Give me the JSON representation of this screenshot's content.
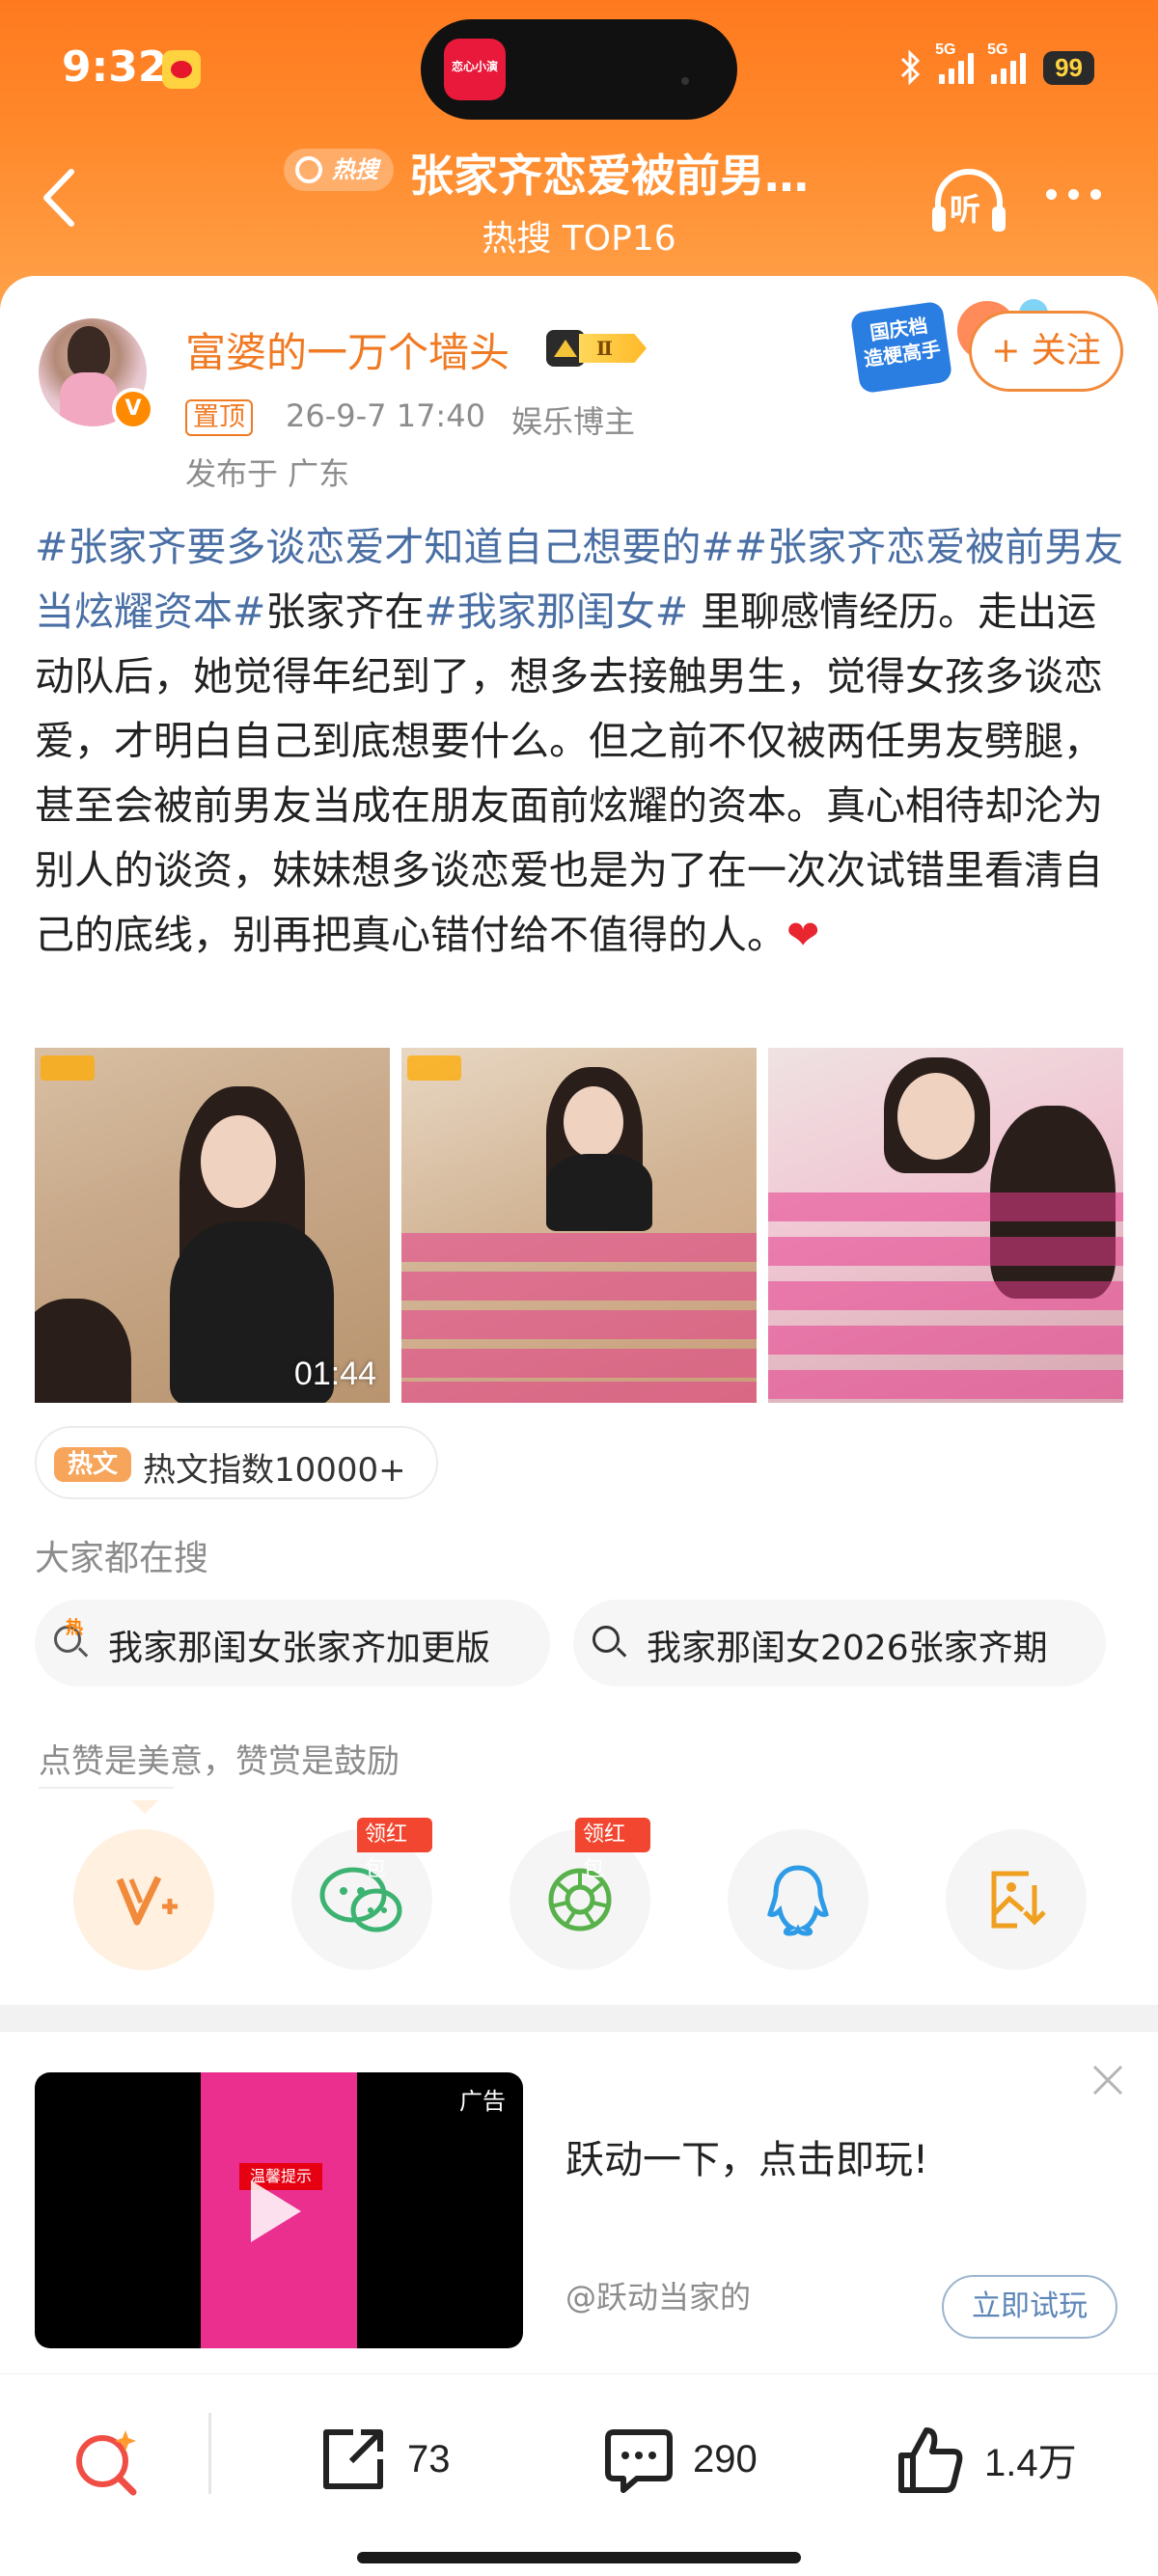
{
  "status": {
    "time": "9:32",
    "signal1": "5G",
    "signal2": "5G",
    "battery": "99",
    "island_app": "恋心小演"
  },
  "nav": {
    "hot_badge": "热搜",
    "title": "张家齐恋爱被前男…",
    "subtitle": "热搜 TOP16",
    "listen_label": "听"
  },
  "post": {
    "username": "富婆的一万个墙头",
    "level": "Ⅱ",
    "verified_mark": "V",
    "pin_label": "置顶",
    "date": "26-9-7 17:40",
    "role": "娱乐博主",
    "location": "发布于 广东",
    "promo_text": "国庆档\n造梗高手",
    "follow_label": "+ 关注",
    "text_parts": {
      "tag1": "#张家齐要多谈恋爱才知道自己想要的#",
      "tag2": "#张家齐恋爱被前男友当炫耀资本#",
      "mid1": "张家齐在",
      "tag3": "#我家那闺女#",
      "body": " 里聊感情经历。走出运动队后，她觉得年纪到了，想多去接触男生，觉得女孩多谈恋爱，才明白自己到底想要什么。但之前不仅被两任男友劈腿，甚至会被前男友当成在朋友面前炫耀的资本。真心相待却沦为别人的谈资，妹妹想多谈恋爱也是为了在一次次试错里看清自己的底线，别再把真心错付给不值得的人。",
      "heart": "❤"
    },
    "video_duration": "01:44"
  },
  "hot_index": {
    "badge": "热文",
    "text": "热文指数10000+"
  },
  "searches": {
    "heading": "大家都在搜",
    "items": [
      "我家那闺女张家齐加更版",
      "我家那闺女2026张家齐期"
    ],
    "hot_mark": "热"
  },
  "reward": {
    "hint": "点赞是美意，赞赏是鼓励",
    "red_packet": "领红包"
  },
  "ad": {
    "label": "广告",
    "title": "跃动一下，点击即玩!",
    "source": "@跃动当家的",
    "cta": "立即试玩",
    "warn": "温馨提示"
  },
  "bottom": {
    "reposts": "73",
    "comments": "290",
    "likes": "1.4万"
  },
  "colors": {
    "brand_orange": "#ff7a1f",
    "username": "#f07a23",
    "topic_blue": "#4a6fa5",
    "red_packet": "#f24630"
  }
}
